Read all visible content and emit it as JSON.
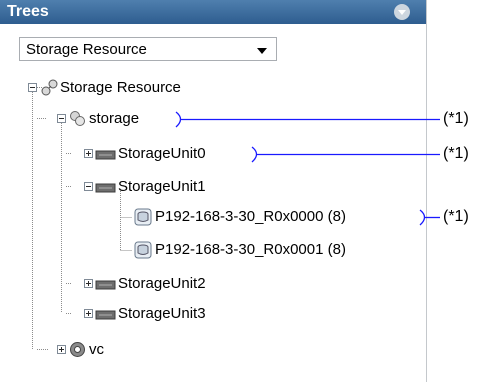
{
  "panel": {
    "title": "Trees"
  },
  "selector": {
    "value": "Storage Resource"
  },
  "tree": {
    "root": {
      "label": "Storage Resource",
      "storage": {
        "label": "storage",
        "units": [
          {
            "label": "StorageUnit0",
            "expanded": false
          },
          {
            "label": "StorageUnit1",
            "expanded": true,
            "volumes": [
              {
                "label": "P192-168-3-30_R0x0000 (8)"
              },
              {
                "label": "P192-168-3-30_R0x0001 (8)"
              }
            ]
          },
          {
            "label": "StorageUnit2",
            "expanded": false
          },
          {
            "label": "StorageUnit3",
            "expanded": false
          }
        ]
      },
      "vc": {
        "label": "vc"
      }
    }
  },
  "callouts": [
    "(*1)",
    "(*1)",
    "(*1)"
  ],
  "colors": {
    "header": "#2e5d8f",
    "callout_line": "#1a1aff",
    "tree_line": "#8c8c8c"
  }
}
